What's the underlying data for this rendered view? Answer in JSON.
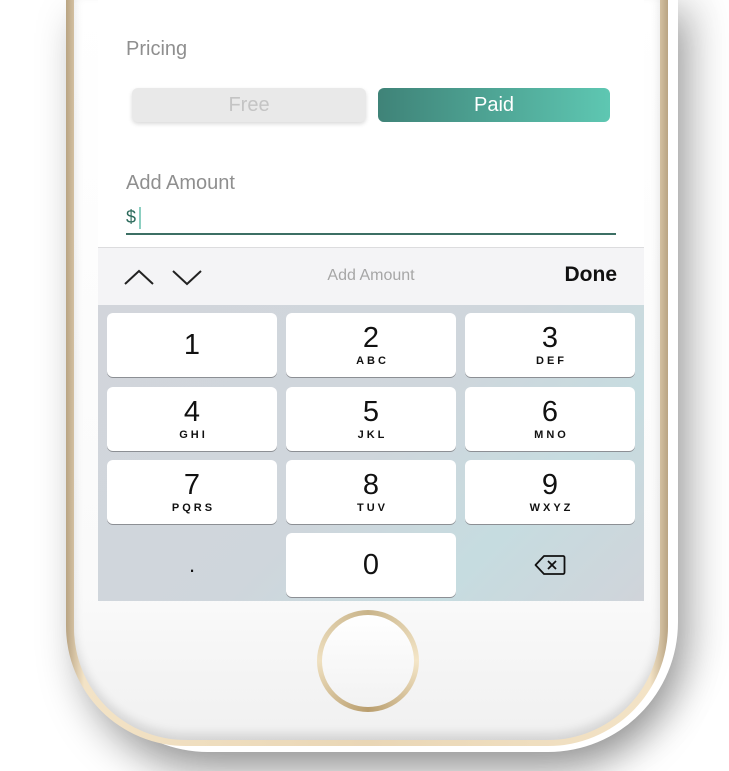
{
  "pricing": {
    "label": "Pricing",
    "options": [
      "Free",
      "Paid"
    ],
    "selected": "Paid"
  },
  "amount": {
    "label": "Add Amount",
    "prefix": "$",
    "value": ""
  },
  "accessory_bar": {
    "title": "Add Amount",
    "done_label": "Done",
    "icons": [
      "chevron-up-icon",
      "chevron-down-icon"
    ]
  },
  "keypad": {
    "keys": [
      {
        "digit": "1",
        "letters": ""
      },
      {
        "digit": "2",
        "letters": "ABC"
      },
      {
        "digit": "3",
        "letters": "DEF"
      },
      {
        "digit": "4",
        "letters": "GHI"
      },
      {
        "digit": "5",
        "letters": "JKL"
      },
      {
        "digit": "6",
        "letters": "MNO"
      },
      {
        "digit": "7",
        "letters": "PQRS"
      },
      {
        "digit": "8",
        "letters": "TUV"
      },
      {
        "digit": "9",
        "letters": "WXYZ"
      },
      {
        "digit": "0",
        "letters": ""
      }
    ],
    "decimal_label": ".",
    "delete_icon": "backspace-icon"
  },
  "colors": {
    "accent_start": "#3f8378",
    "accent_end": "#5ec7b2"
  }
}
